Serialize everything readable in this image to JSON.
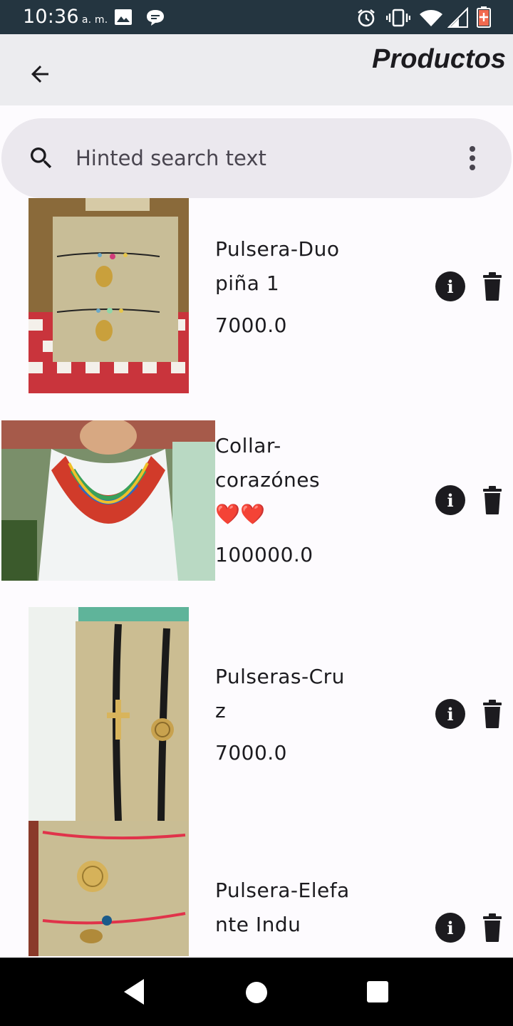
{
  "status_bar": {
    "time": "10:36",
    "ampm": "a. m.",
    "icons": [
      "image-icon",
      "message-icon",
      "alarm-icon",
      "vibrate-icon",
      "wifi-icon",
      "signal-icon",
      "battery-icon"
    ]
  },
  "app_bar": {
    "title": "Productos",
    "back_icon": "arrow-back-icon"
  },
  "search": {
    "placeholder": "Hinted search text",
    "value": ""
  },
  "products": [
    {
      "name": "Pulsera-Duo\npiña 1",
      "price": "7000.0"
    },
    {
      "name": "Collar-\ncorazónes\n❤️❤️",
      "price": "100000.0"
    },
    {
      "name": "Pulseras-Cru\nz",
      "price": "7000.0"
    },
    {
      "name": "Pulsera-Elefa\nnte Indu",
      "price": ""
    }
  ],
  "colors": {
    "status_bar": "#243540",
    "app_bar": "#ececef",
    "search_bar": "#ebe8ee",
    "background": "#fdfbfe",
    "icon": "#1c1b1f"
  }
}
